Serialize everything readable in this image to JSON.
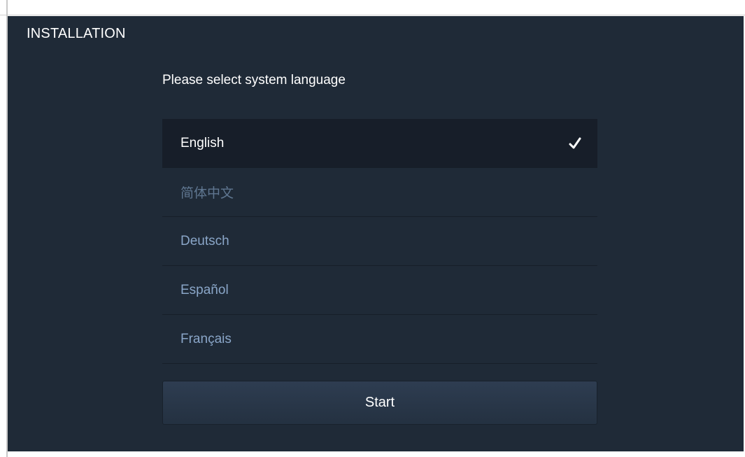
{
  "header": {
    "title": "INSTALLATION"
  },
  "main": {
    "prompt": "Please select system language",
    "languages": [
      {
        "label": "English",
        "selected": true
      },
      {
        "label": "简体中文",
        "selected": false
      },
      {
        "label": "Deutsch",
        "selected": false
      },
      {
        "label": "Español",
        "selected": false
      },
      {
        "label": "Français",
        "selected": false
      }
    ],
    "selected_icon": "checkmark-icon",
    "start_label": "Start"
  },
  "colors": {
    "background": "#1f2a37",
    "selected_row": "#171e29",
    "unselected_text": "#8aa6c8"
  }
}
